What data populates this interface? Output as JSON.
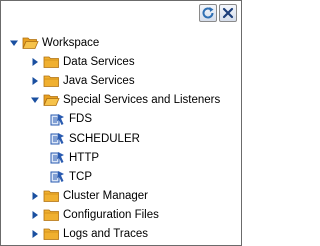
{
  "toolbar": {
    "refresh_icon": "refresh-icon",
    "close_icon": "close-icon",
    "accent": "#2f6fb3",
    "close_color": "#1d3f7a"
  },
  "tree": {
    "root": {
      "label": "Workspace",
      "expanded": true,
      "children": [
        {
          "label": "Data Services",
          "expanded": false
        },
        {
          "label": "Java Services",
          "expanded": false
        },
        {
          "label": "Special Services and Listeners",
          "expanded": true,
          "children": [
            {
              "label": "FDS"
            },
            {
              "label": "SCHEDULER"
            },
            {
              "label": "HTTP"
            },
            {
              "label": "TCP"
            }
          ]
        },
        {
          "label": "Cluster Manager",
          "expanded": false
        },
        {
          "label": "Configuration Files",
          "expanded": false
        },
        {
          "label": "Logs and Traces",
          "expanded": false
        }
      ]
    },
    "colors": {
      "folder": "#f0b030",
      "folder_dark": "#c07c10",
      "twisty": "#1a4fa0",
      "service": "#2a5bb0"
    }
  }
}
